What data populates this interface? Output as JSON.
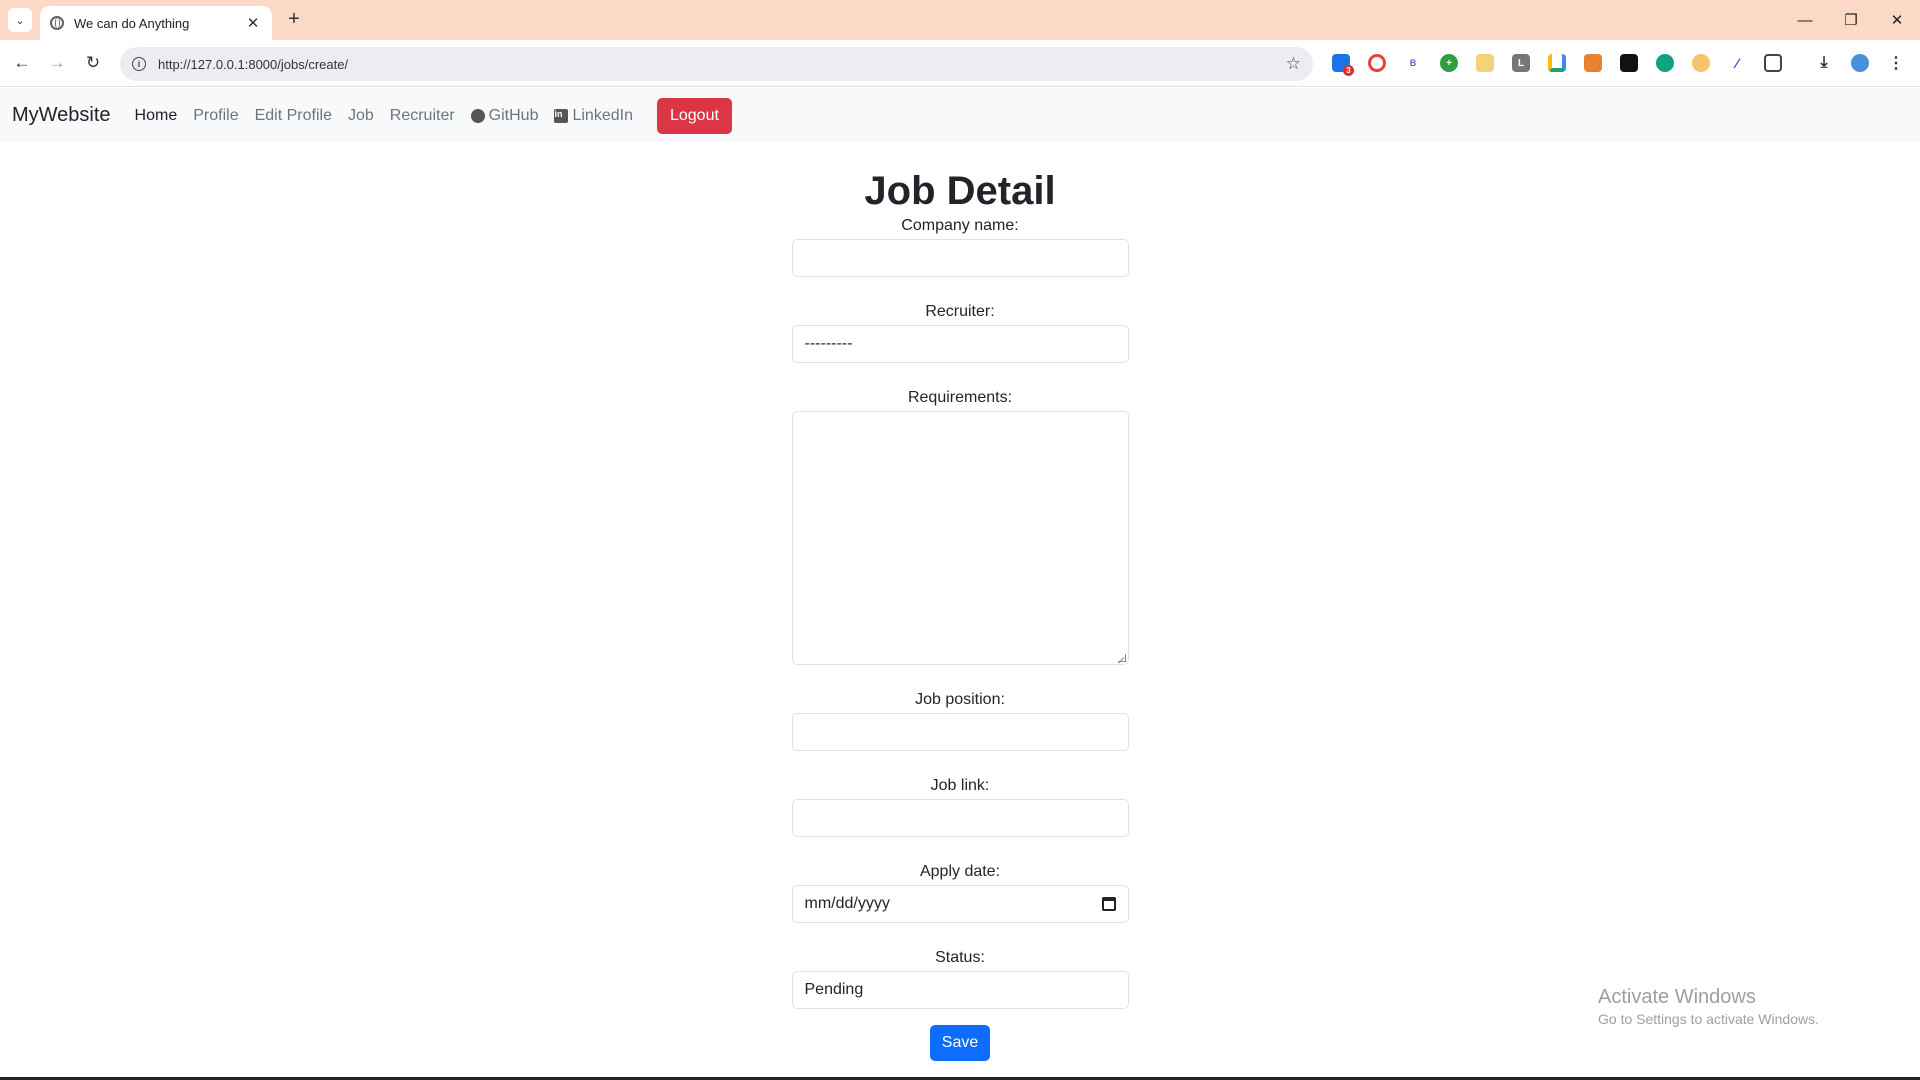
{
  "browser": {
    "tab_title": "We can do Anything",
    "url": "http://127.0.0.1:8000/jobs/create/",
    "extension_badge": "3"
  },
  "navbar": {
    "brand": "MyWebsite",
    "links": [
      "Home",
      "Profile",
      "Edit Profile",
      "Job",
      "Recruiter",
      "GitHub",
      "LinkedIn"
    ],
    "logout": "Logout"
  },
  "form": {
    "title": "Job Detail",
    "company_label": "Company name:",
    "company_value": "",
    "recruiter_label": "Recruiter:",
    "recruiter_value": "---------",
    "requirements_label": "Requirements:",
    "requirements_value": "",
    "position_label": "Job position:",
    "position_value": "",
    "link_label": "Job link:",
    "link_value": "",
    "date_label": "Apply date:",
    "date_placeholder": "mm/dd/yyyy",
    "status_label": "Status:",
    "status_value": "Pending",
    "save": "Save"
  },
  "watermark": {
    "line1": "Activate Windows",
    "line2": "Go to Settings to activate Windows."
  },
  "colors": {
    "tabstrip": "#fcd9c7",
    "danger": "#dc3545",
    "primary": "#0d6efd"
  }
}
